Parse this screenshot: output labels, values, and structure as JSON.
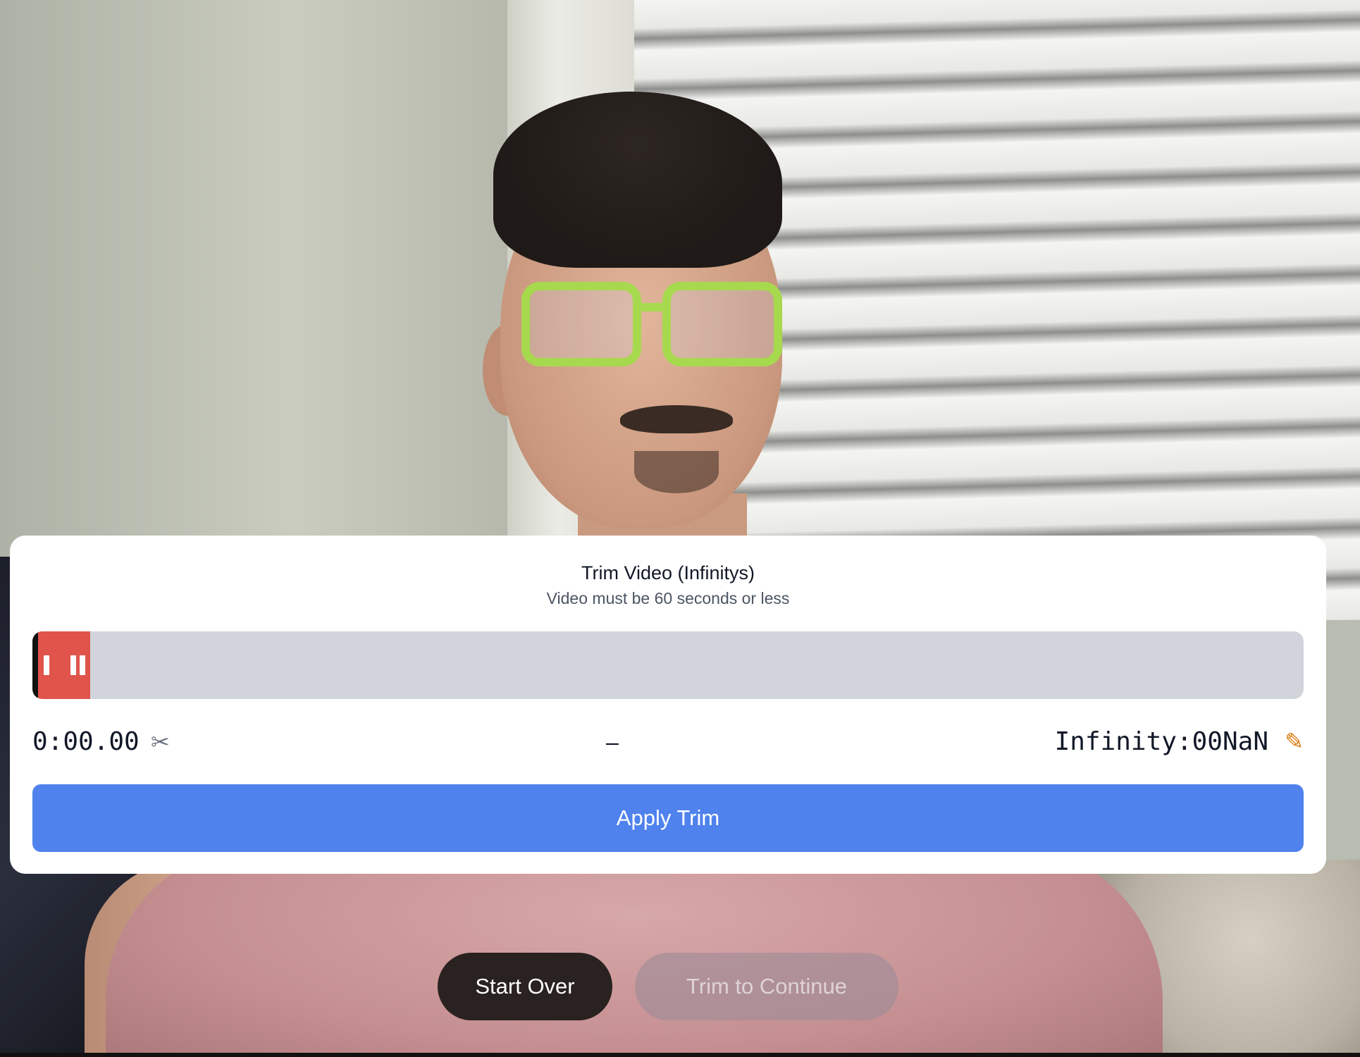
{
  "trim_panel": {
    "title": "Trim Video (Infinitys)",
    "subtitle": "Video must be 60 seconds or less",
    "start_time": "0:00.00",
    "separator": "–",
    "end_time": "Infinity:00NaN",
    "apply_label": "Apply Trim",
    "selection_fraction": 0.04
  },
  "icons": {
    "start_edit": "scissors-icon",
    "end_edit": "pencil-icon"
  },
  "actions": {
    "start_over_label": "Start Over",
    "continue_label": "Trim to Continue",
    "continue_disabled": true
  },
  "colors": {
    "accent": "#4f82ed",
    "selection": "#e0544b",
    "track": "#d1d5db"
  }
}
